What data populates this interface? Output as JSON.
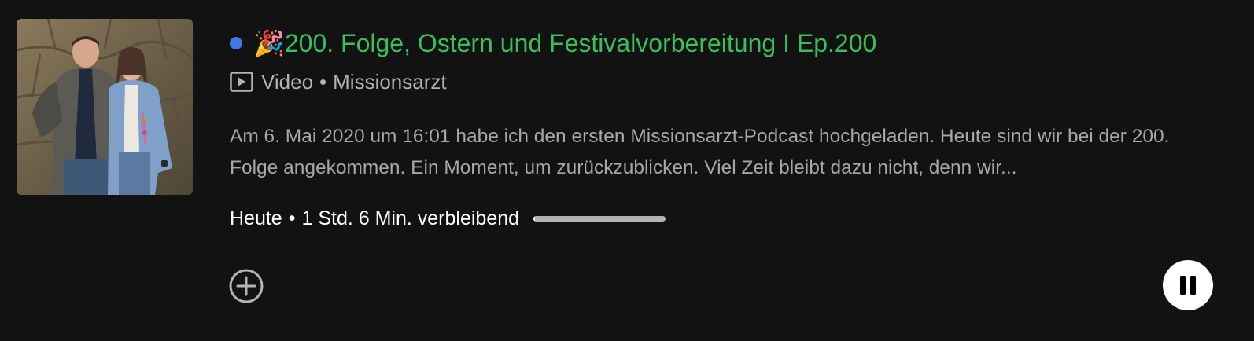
{
  "episode": {
    "is_new": true,
    "title_emoji": "🎉",
    "title": "200. Folge, Ostern und Festivalvorbereitung I Ep.200",
    "media_type": "Video",
    "show_name": "Missionsarzt",
    "description": "Am 6. Mai 2020 um 16:01 habe ich den ersten Missionsarzt-Podcast hochgeladen. Heute sind wir bei der 200. Folge angekommen. Ein Moment, um zurückzublicken. Viel Zeit bleibt dazu nicht, denn wir...",
    "date": "Heute",
    "remaining": "1 Std. 6 Min. verbleibend",
    "progress": 0.01
  },
  "separator": "•",
  "icons": {
    "media": "video-icon",
    "add": "plus-circle-icon",
    "play_state": "pause-icon"
  },
  "colors": {
    "background": "#121212",
    "title": "#3bbd5c",
    "new_dot": "#3d7be0",
    "secondary_text": "#b3b3b3",
    "primary_text": "#ffffff"
  }
}
